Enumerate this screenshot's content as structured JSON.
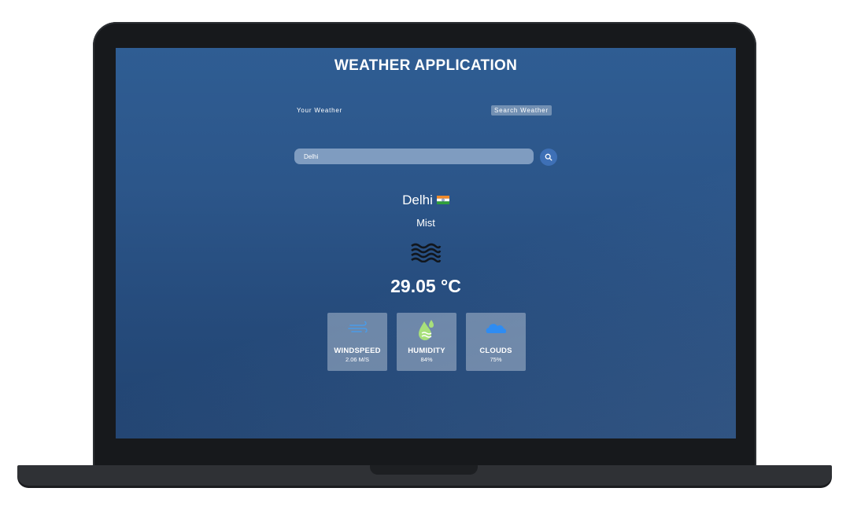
{
  "app": {
    "title": "WEATHER APPLICATION"
  },
  "tabs": {
    "your_weather": "Your Weather",
    "search_weather": "Search Weather"
  },
  "search": {
    "value": "Delhi",
    "button_icon": "search-icon"
  },
  "weather": {
    "city": "Delhi",
    "flag_icon": "india-flag-icon",
    "condition": "Mist",
    "condition_icon": "mist-icon",
    "temperature": "29.05 °C"
  },
  "stats": [
    {
      "label": "WINDSPEED",
      "value": "2.06 M/S",
      "icon": "wind-icon",
      "icon_color": "#4a9be8"
    },
    {
      "label": "HUMIDITY",
      "value": "84%",
      "icon": "humidity-drop-icon",
      "icon_color": "#a8e07a"
    },
    {
      "label": "CLOUDS",
      "value": "75%",
      "icon": "cloud-icon",
      "icon_color": "#2f8cf2"
    }
  ],
  "colors": {
    "screen_top": "#2f5d93",
    "screen_bottom": "#214370",
    "search_button": "#3e70b6"
  }
}
